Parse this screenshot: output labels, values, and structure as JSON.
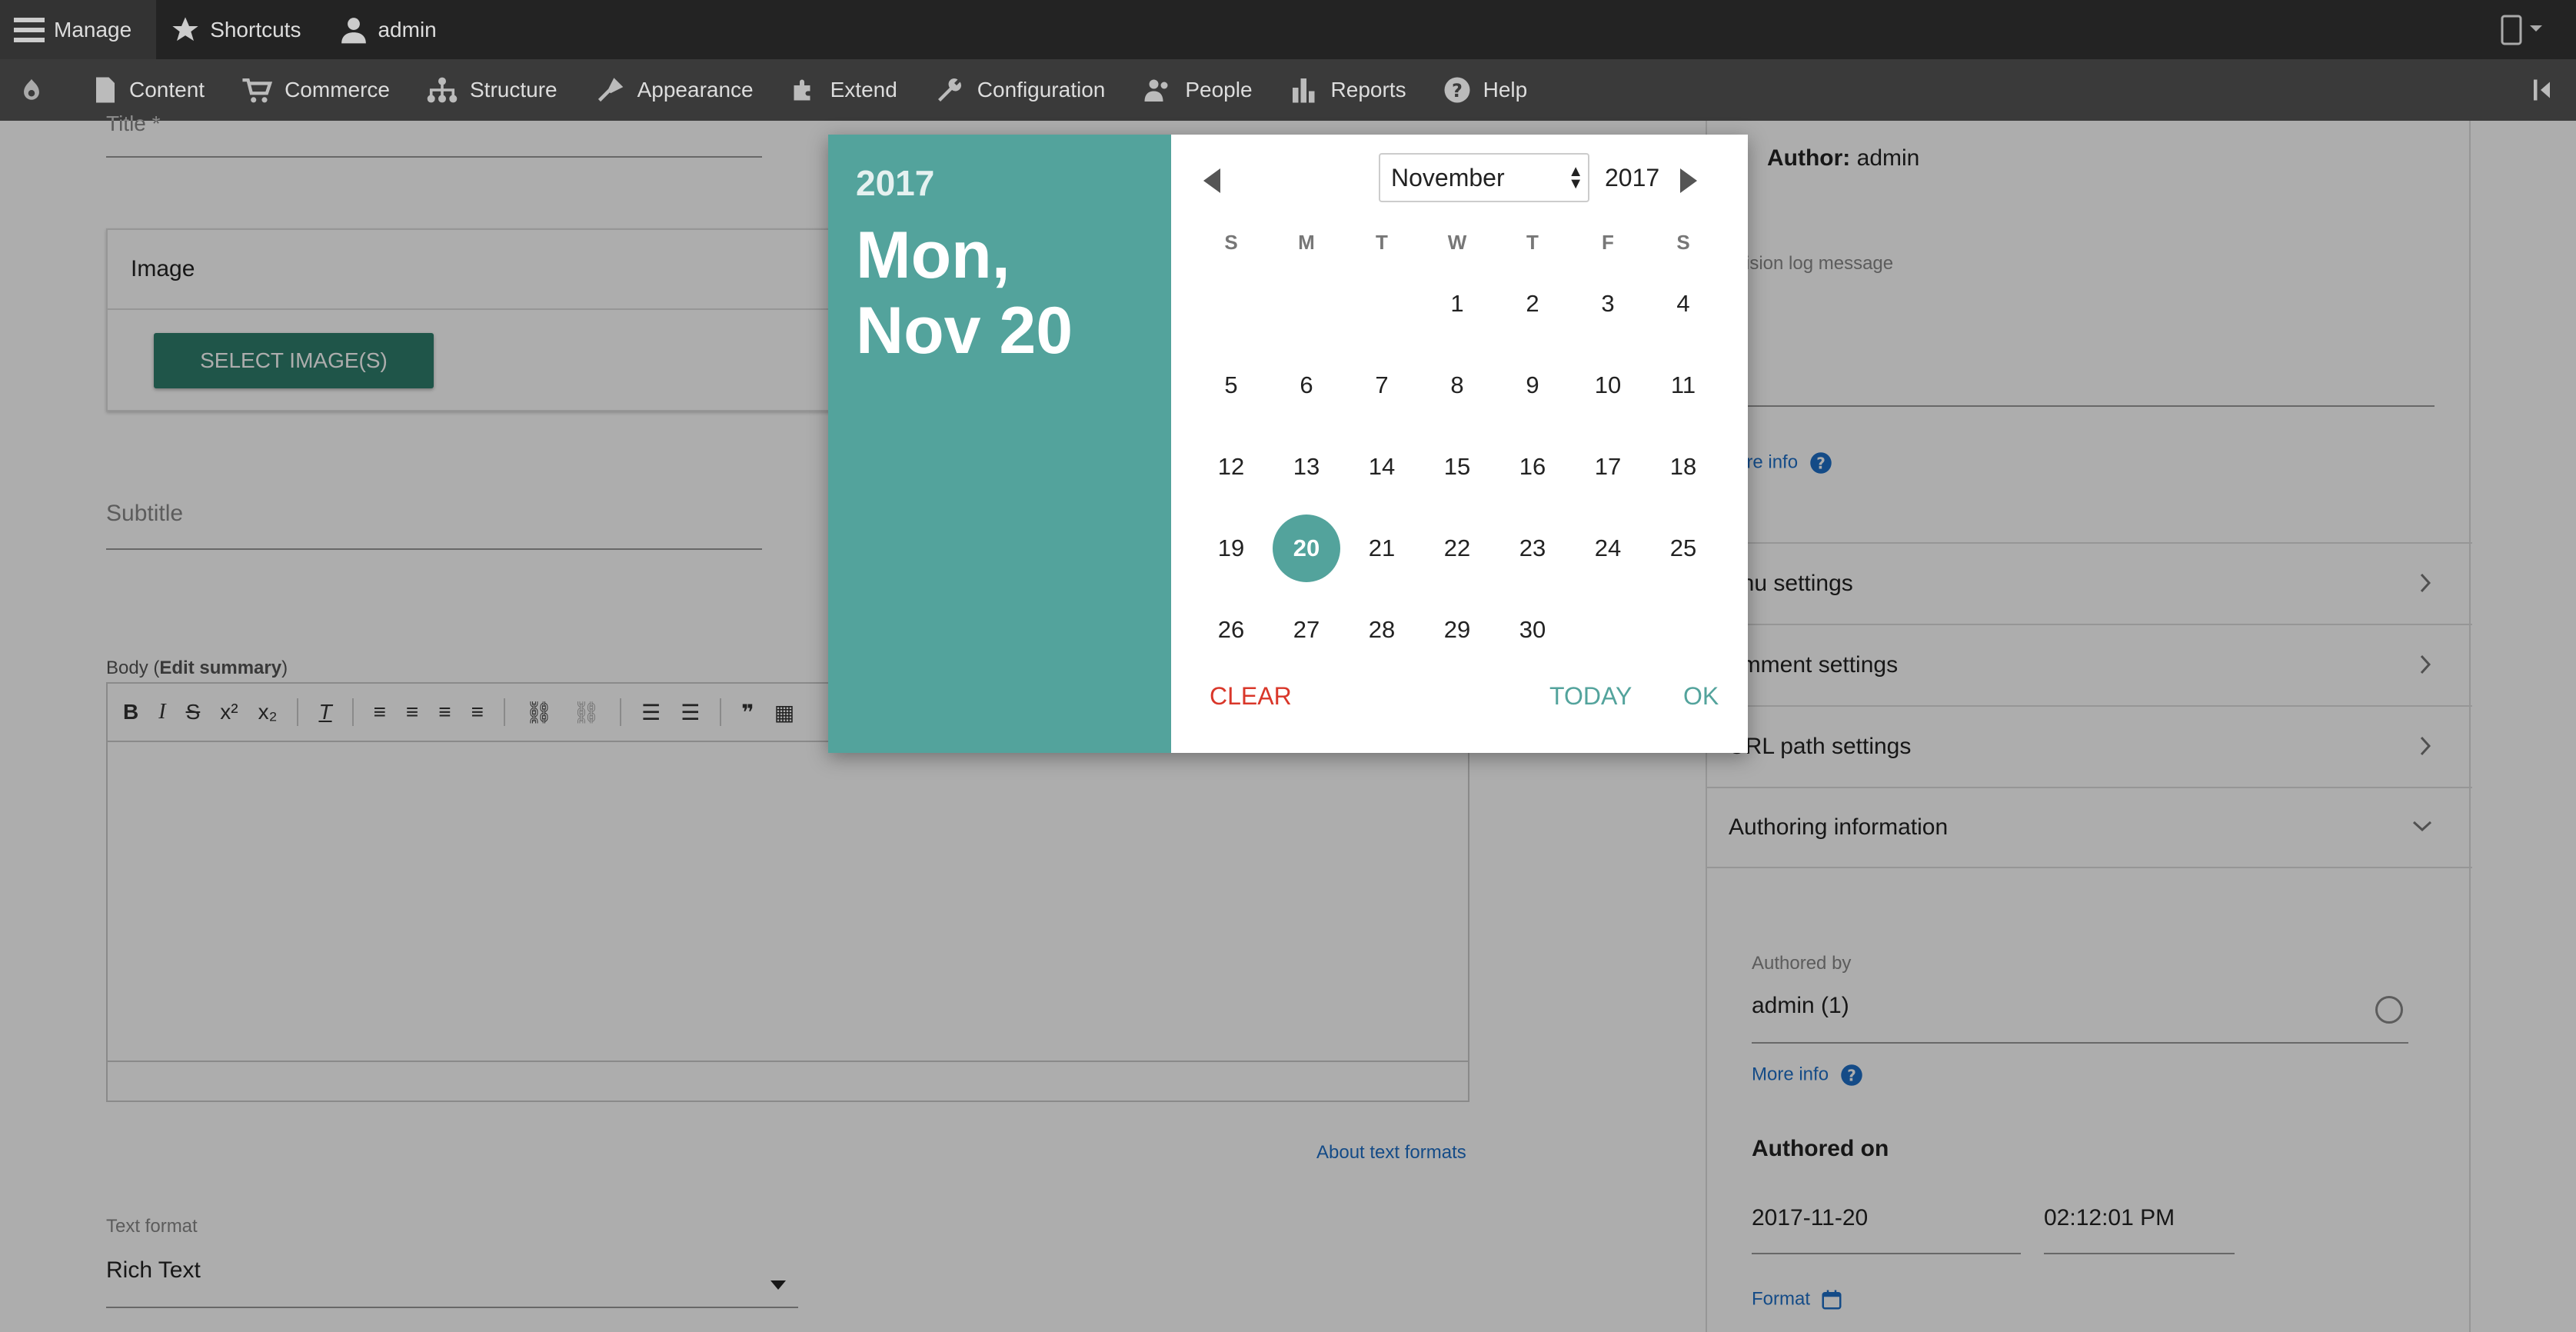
{
  "toolbar": {
    "manage": "Manage",
    "shortcuts": "Shortcuts",
    "user": "admin"
  },
  "admin_menu": [
    {
      "label": "Content",
      "icon": "document-icon"
    },
    {
      "label": "Commerce",
      "icon": "cart-icon"
    },
    {
      "label": "Structure",
      "icon": "structure-icon"
    },
    {
      "label": "Appearance",
      "icon": "brush-icon"
    },
    {
      "label": "Extend",
      "icon": "puzzle-icon"
    },
    {
      "label": "Configuration",
      "icon": "wrench-icon"
    },
    {
      "label": "People",
      "icon": "people-icon"
    },
    {
      "label": "Reports",
      "icon": "bar-chart-icon"
    },
    {
      "label": "Help",
      "icon": "help-icon"
    }
  ],
  "form": {
    "title_label": "Title *",
    "image_label": "Image",
    "select_images": "SELECT IMAGE(S)",
    "subtitle_label": "Subtitle",
    "body_label": "Body",
    "edit_summary": "Edit summary",
    "about_text_formats": "About text formats",
    "text_format_label": "Text format",
    "text_format_value": "Rich Text"
  },
  "sidebar": {
    "author_label": "Author:",
    "author_value": "admin",
    "revision_label": "vision log message",
    "more_info_1": "ore info",
    "menu_settings": "enu settings",
    "comment_settings": "omment settings",
    "url_settings": "URL path settings",
    "authoring_info": "Authoring information",
    "authored_by_label": "Authored by",
    "authored_by_value": "admin (1)",
    "more_info_2": "More info",
    "authored_on_label": "Authored on",
    "date_value": "2017-11-20",
    "time_value": "02:12:01 PM",
    "format_label": "Format"
  },
  "picker": {
    "header_year": "2017",
    "header_date_line1": "Mon,",
    "header_date_line2": "Nov 20",
    "month": "November",
    "year": "2017",
    "weekdays": [
      "S",
      "M",
      "T",
      "W",
      "T",
      "F",
      "S"
    ],
    "weeks": [
      [
        "",
        "",
        "",
        "1",
        "2",
        "3",
        "4"
      ],
      [
        "5",
        "6",
        "7",
        "8",
        "9",
        "10",
        "11"
      ],
      [
        "12",
        "13",
        "14",
        "15",
        "16",
        "17",
        "18"
      ],
      [
        "19",
        "20",
        "21",
        "22",
        "23",
        "24",
        "25"
      ],
      [
        "26",
        "27",
        "28",
        "29",
        "30",
        "",
        ""
      ]
    ],
    "selected_day": "20",
    "clear": "CLEAR",
    "today": "TODAY",
    "ok": "OK"
  },
  "colors": {
    "picker_teal": "#53a39c",
    "clear_red": "#d9372a",
    "button_green": "#2e7e6c",
    "link_blue": "#1e6fc7"
  }
}
